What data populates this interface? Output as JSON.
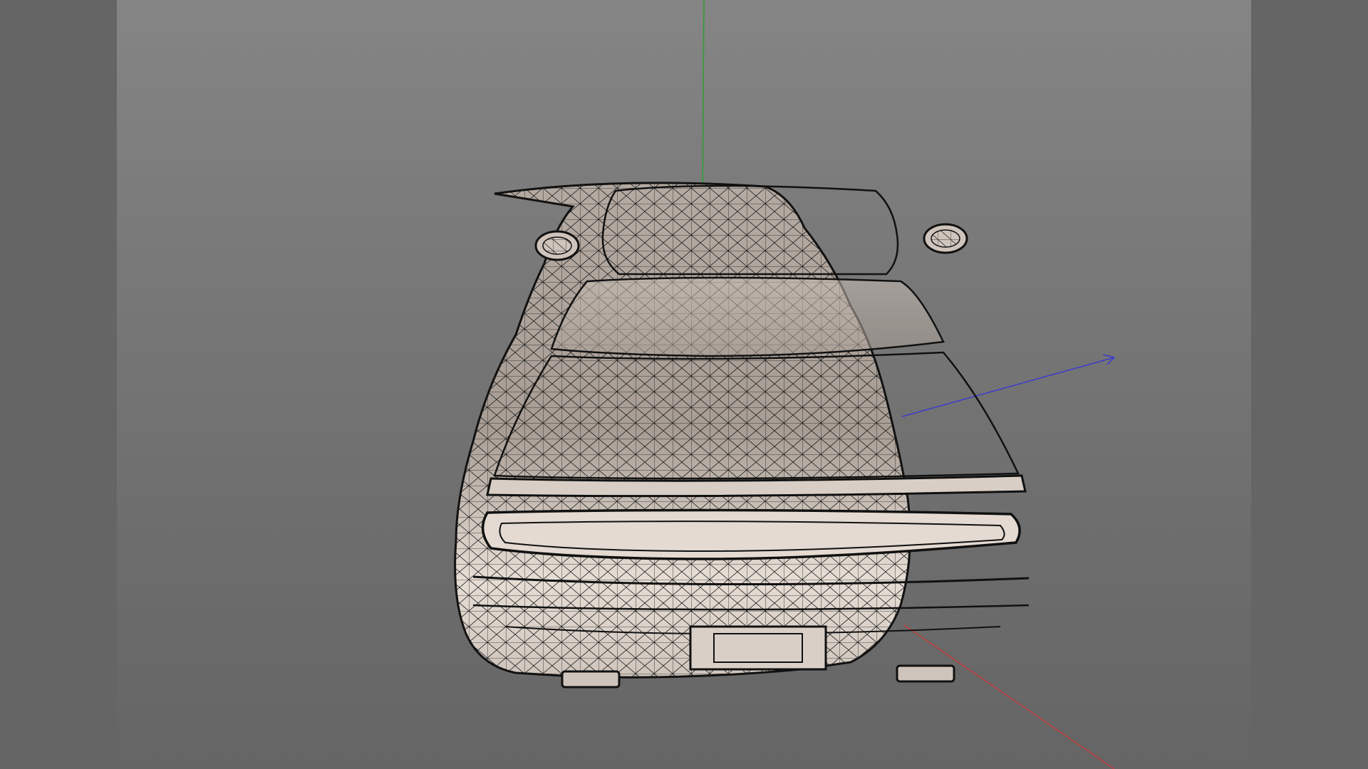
{
  "app": {
    "title": ""
  },
  "viewport": {
    "mode": "wireframe-shaded",
    "object": "car-model",
    "background_top": "#858585",
    "background_bottom": "#656565"
  },
  "axes": {
    "x_color": "#c23b3b",
    "y_color": "#2f9d2f",
    "z_color": "#3a3ad0"
  },
  "colors": {
    "surface": "#b9aea6",
    "surface_light": "#e6ddd4",
    "wire": "#1a1a1a",
    "panel": "#656565"
  }
}
